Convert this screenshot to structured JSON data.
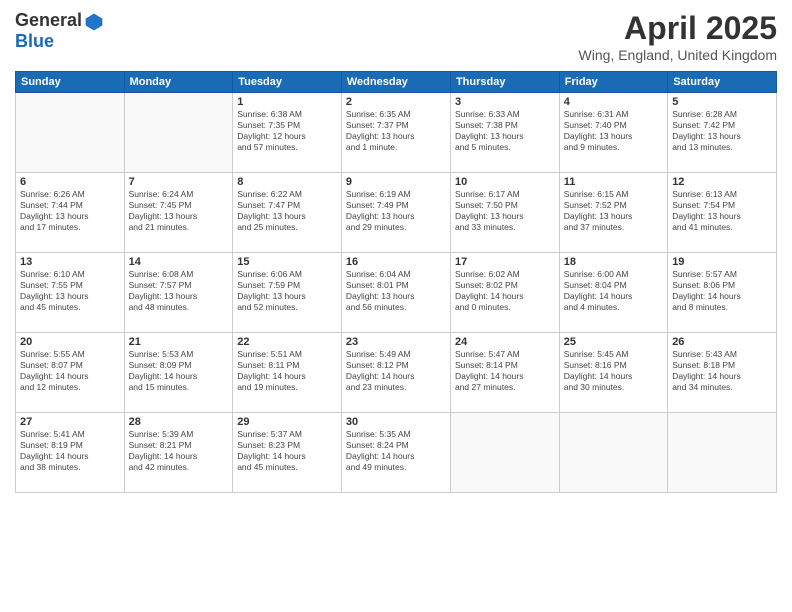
{
  "logo": {
    "general": "General",
    "blue": "Blue"
  },
  "header": {
    "month_year": "April 2025",
    "location": "Wing, England, United Kingdom"
  },
  "weekdays": [
    "Sunday",
    "Monday",
    "Tuesday",
    "Wednesday",
    "Thursday",
    "Friday",
    "Saturday"
  ],
  "weeks": [
    [
      {
        "day": "",
        "info": ""
      },
      {
        "day": "",
        "info": ""
      },
      {
        "day": "1",
        "info": "Sunrise: 6:38 AM\nSunset: 7:35 PM\nDaylight: 12 hours\nand 57 minutes."
      },
      {
        "day": "2",
        "info": "Sunrise: 6:35 AM\nSunset: 7:37 PM\nDaylight: 13 hours\nand 1 minute."
      },
      {
        "day": "3",
        "info": "Sunrise: 6:33 AM\nSunset: 7:38 PM\nDaylight: 13 hours\nand 5 minutes."
      },
      {
        "day": "4",
        "info": "Sunrise: 6:31 AM\nSunset: 7:40 PM\nDaylight: 13 hours\nand 9 minutes."
      },
      {
        "day": "5",
        "info": "Sunrise: 6:28 AM\nSunset: 7:42 PM\nDaylight: 13 hours\nand 13 minutes."
      }
    ],
    [
      {
        "day": "6",
        "info": "Sunrise: 6:26 AM\nSunset: 7:44 PM\nDaylight: 13 hours\nand 17 minutes."
      },
      {
        "day": "7",
        "info": "Sunrise: 6:24 AM\nSunset: 7:45 PM\nDaylight: 13 hours\nand 21 minutes."
      },
      {
        "day": "8",
        "info": "Sunrise: 6:22 AM\nSunset: 7:47 PM\nDaylight: 13 hours\nand 25 minutes."
      },
      {
        "day": "9",
        "info": "Sunrise: 6:19 AM\nSunset: 7:49 PM\nDaylight: 13 hours\nand 29 minutes."
      },
      {
        "day": "10",
        "info": "Sunrise: 6:17 AM\nSunset: 7:50 PM\nDaylight: 13 hours\nand 33 minutes."
      },
      {
        "day": "11",
        "info": "Sunrise: 6:15 AM\nSunset: 7:52 PM\nDaylight: 13 hours\nand 37 minutes."
      },
      {
        "day": "12",
        "info": "Sunrise: 6:13 AM\nSunset: 7:54 PM\nDaylight: 13 hours\nand 41 minutes."
      }
    ],
    [
      {
        "day": "13",
        "info": "Sunrise: 6:10 AM\nSunset: 7:55 PM\nDaylight: 13 hours\nand 45 minutes."
      },
      {
        "day": "14",
        "info": "Sunrise: 6:08 AM\nSunset: 7:57 PM\nDaylight: 13 hours\nand 48 minutes."
      },
      {
        "day": "15",
        "info": "Sunrise: 6:06 AM\nSunset: 7:59 PM\nDaylight: 13 hours\nand 52 minutes."
      },
      {
        "day": "16",
        "info": "Sunrise: 6:04 AM\nSunset: 8:01 PM\nDaylight: 13 hours\nand 56 minutes."
      },
      {
        "day": "17",
        "info": "Sunrise: 6:02 AM\nSunset: 8:02 PM\nDaylight: 14 hours\nand 0 minutes."
      },
      {
        "day": "18",
        "info": "Sunrise: 6:00 AM\nSunset: 8:04 PM\nDaylight: 14 hours\nand 4 minutes."
      },
      {
        "day": "19",
        "info": "Sunrise: 5:57 AM\nSunset: 8:06 PM\nDaylight: 14 hours\nand 8 minutes."
      }
    ],
    [
      {
        "day": "20",
        "info": "Sunrise: 5:55 AM\nSunset: 8:07 PM\nDaylight: 14 hours\nand 12 minutes."
      },
      {
        "day": "21",
        "info": "Sunrise: 5:53 AM\nSunset: 8:09 PM\nDaylight: 14 hours\nand 15 minutes."
      },
      {
        "day": "22",
        "info": "Sunrise: 5:51 AM\nSunset: 8:11 PM\nDaylight: 14 hours\nand 19 minutes."
      },
      {
        "day": "23",
        "info": "Sunrise: 5:49 AM\nSunset: 8:12 PM\nDaylight: 14 hours\nand 23 minutes."
      },
      {
        "day": "24",
        "info": "Sunrise: 5:47 AM\nSunset: 8:14 PM\nDaylight: 14 hours\nand 27 minutes."
      },
      {
        "day": "25",
        "info": "Sunrise: 5:45 AM\nSunset: 8:16 PM\nDaylight: 14 hours\nand 30 minutes."
      },
      {
        "day": "26",
        "info": "Sunrise: 5:43 AM\nSunset: 8:18 PM\nDaylight: 14 hours\nand 34 minutes."
      }
    ],
    [
      {
        "day": "27",
        "info": "Sunrise: 5:41 AM\nSunset: 8:19 PM\nDaylight: 14 hours\nand 38 minutes."
      },
      {
        "day": "28",
        "info": "Sunrise: 5:39 AM\nSunset: 8:21 PM\nDaylight: 14 hours\nand 42 minutes."
      },
      {
        "day": "29",
        "info": "Sunrise: 5:37 AM\nSunset: 8:23 PM\nDaylight: 14 hours\nand 45 minutes."
      },
      {
        "day": "30",
        "info": "Sunrise: 5:35 AM\nSunset: 8:24 PM\nDaylight: 14 hours\nand 49 minutes."
      },
      {
        "day": "",
        "info": ""
      },
      {
        "day": "",
        "info": ""
      },
      {
        "day": "",
        "info": ""
      }
    ]
  ]
}
